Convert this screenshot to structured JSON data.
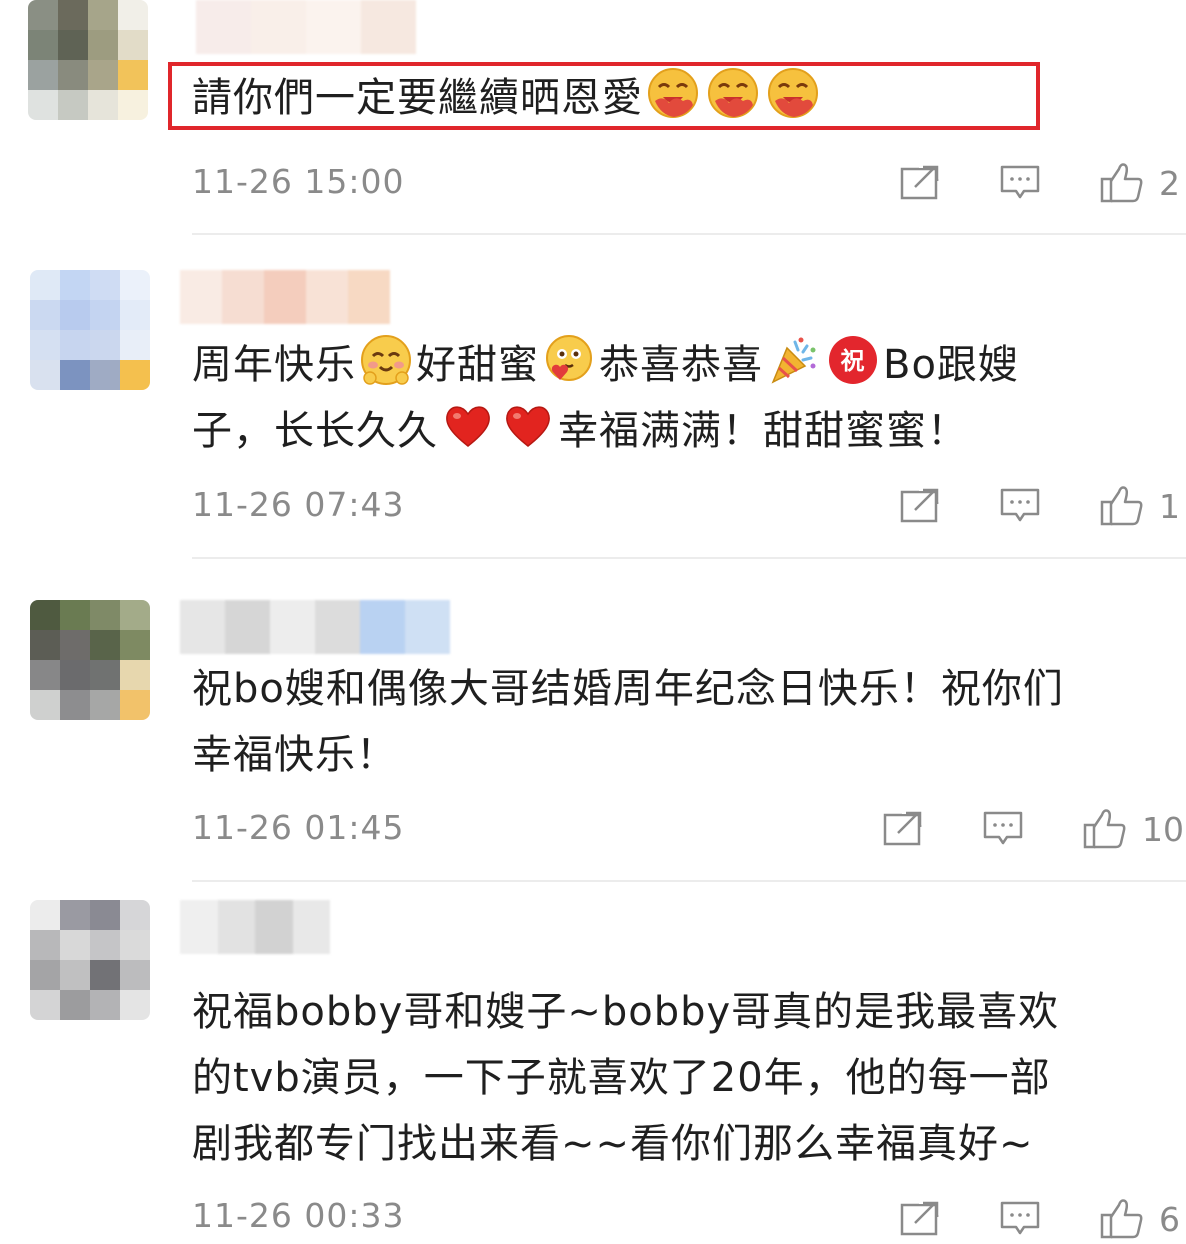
{
  "comments": [
    {
      "text_lines": [
        [
          "請你們一定要繼續晒恩愛",
          "emoji:hug",
          "emoji:hug",
          "emoji:hug"
        ]
      ],
      "timestamp": "11-26 15:00",
      "like_count": "2",
      "highlighted": true
    },
    {
      "text_lines": [
        [
          "周年快乐",
          "emoji:blush",
          "好甜蜜",
          "emoji:love",
          "恭喜恭喜",
          "emoji:party",
          "emoji:zhu",
          "Bo跟嫂"
        ],
        [
          "子，长长久久",
          "emoji:heart",
          "emoji:heart",
          "幸福满满！甜甜蜜蜜！"
        ]
      ],
      "timestamp": "11-26 07:43",
      "like_count": "1",
      "highlighted": false
    },
    {
      "text_lines": [
        [
          "祝bo嫂和偶像大哥结婚周年纪念日快乐！祝你们"
        ],
        [
          "幸福快乐！"
        ]
      ],
      "timestamp": "11-26 01:45",
      "like_count": "10",
      "highlighted": false
    },
    {
      "text_lines": [
        [
          "祝福bobby哥和嫂子~bobby哥真的是我最喜欢"
        ],
        [
          "的tvb演员，一下子就喜欢了20年，他的每一部"
        ],
        [
          "剧我都专门找出来看~~看你们那么幸福真好~"
        ]
      ],
      "timestamp": "11-26 00:33",
      "like_count": "6",
      "highlighted": false
    }
  ],
  "icons": {
    "share": "share-icon",
    "comment": "comment-icon",
    "like": "like-icon"
  },
  "colors": {
    "highlight_border": "#e0262b",
    "meta_text": "#8a8a8a",
    "body_text": "#1f1f1f"
  }
}
